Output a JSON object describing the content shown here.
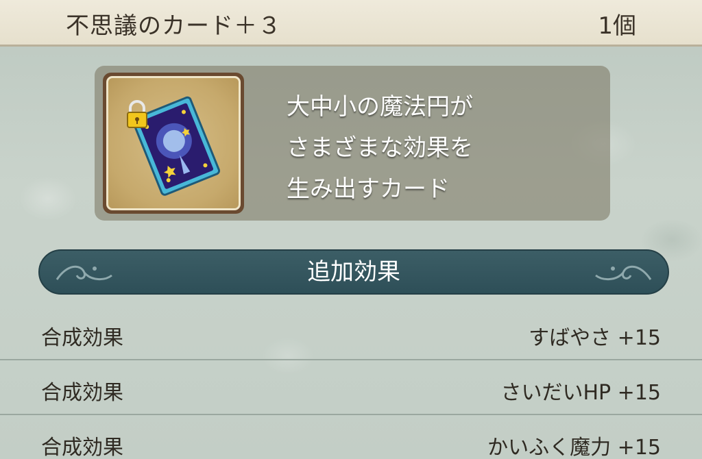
{
  "header": {
    "item_name": "不思議のカード＋３",
    "count": "1個"
  },
  "item": {
    "icon": "magic-card-icon",
    "locked": true,
    "description": "大中小の魔法円が\nさまざまな効果を\n生み出すカード"
  },
  "section": {
    "title": "追加効果"
  },
  "effects": [
    {
      "label": "合成効果",
      "value": "すばやさ +15"
    },
    {
      "label": "合成効果",
      "value": "さいだいHP +15"
    },
    {
      "label": "合成効果",
      "value": "かいふく魔力 +15"
    }
  ],
  "colors": {
    "banner": "#2e4f58",
    "header_bg": "#e6e0cd",
    "background": "#c5cfc7"
  }
}
